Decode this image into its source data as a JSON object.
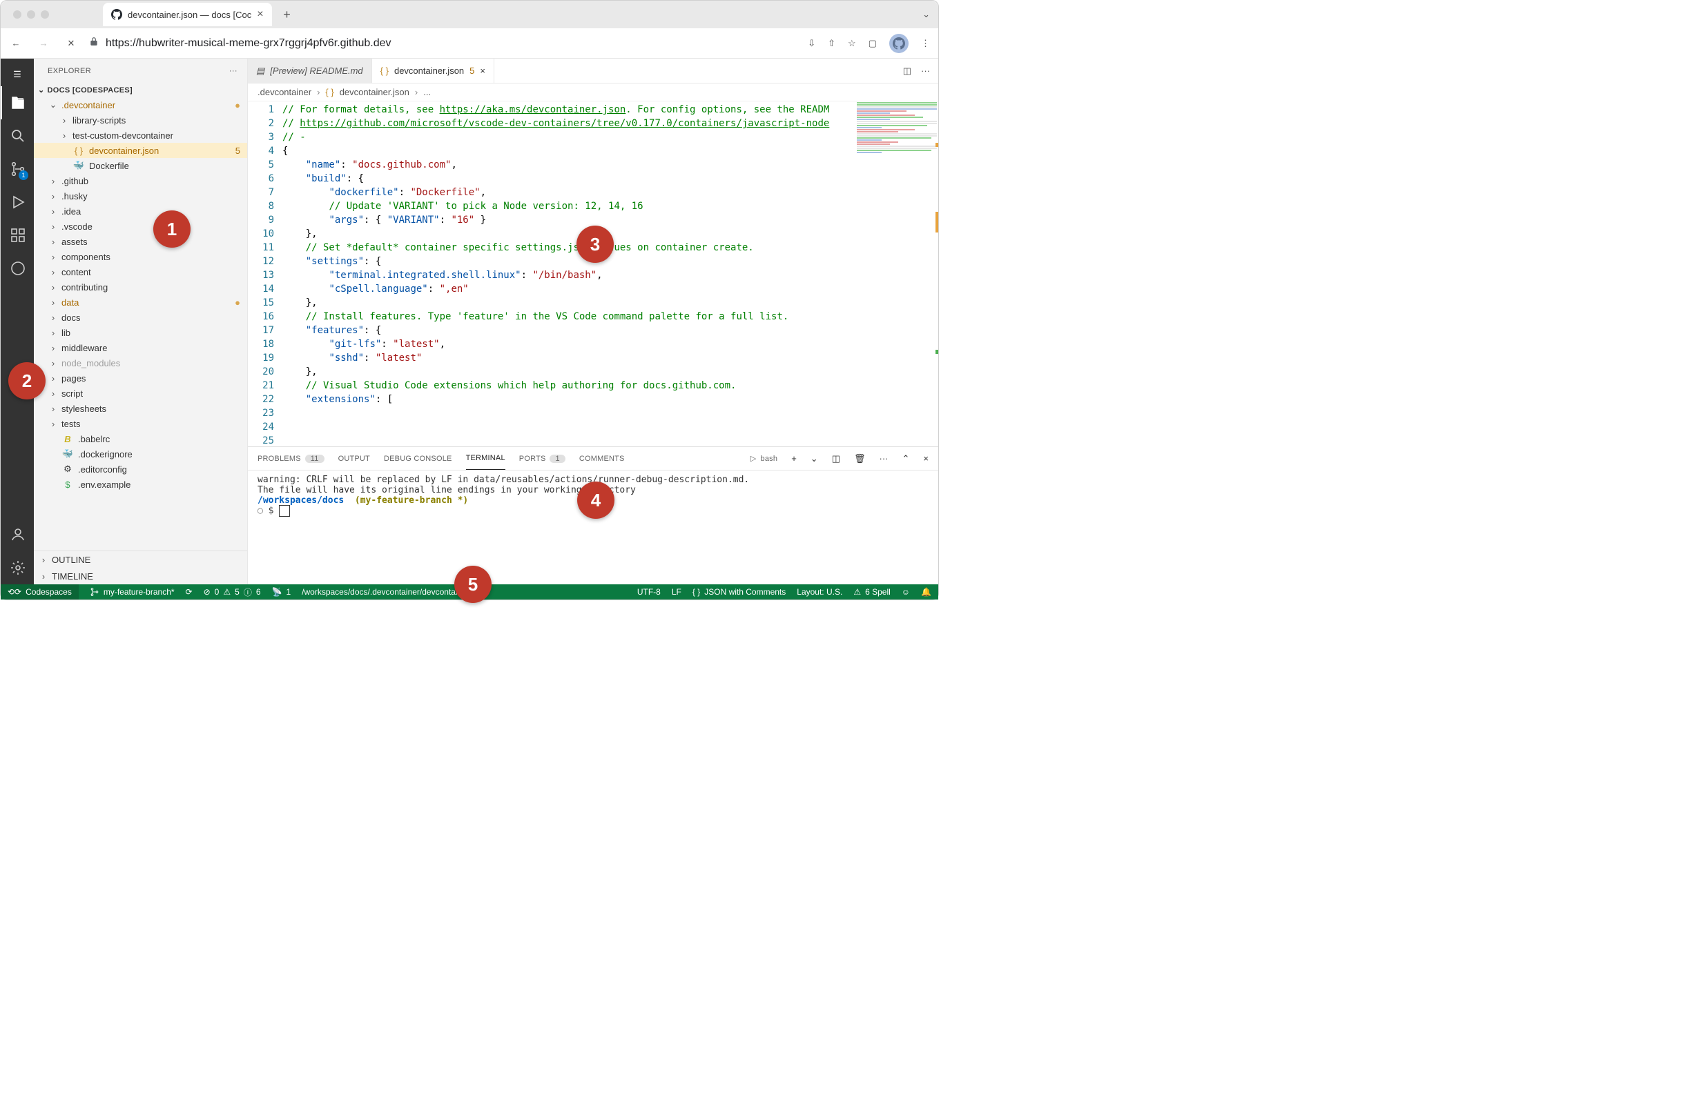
{
  "browser": {
    "tab_title": "devcontainer.json — docs [Coc",
    "url": "https://hubwriter-musical-meme-grx7rggrj4pfv6r.github.dev"
  },
  "sidebar": {
    "title": "EXPLORER",
    "section": "DOCS [CODESPACES]",
    "outline_label": "OUTLINE",
    "timeline_label": "TIMELINE",
    "tree": [
      {
        "indent": 1,
        "kind": "folder-open",
        "label": ".devcontainer",
        "class": "orange",
        "dot": true
      },
      {
        "indent": 2,
        "kind": "folder",
        "label": "library-scripts"
      },
      {
        "indent": 2,
        "kind": "folder",
        "label": "test-custom-devcontainer"
      },
      {
        "indent": 2,
        "kind": "json",
        "label": "devcontainer.json",
        "class": "orange",
        "selected": true,
        "badge": "5"
      },
      {
        "indent": 2,
        "kind": "docker",
        "label": "Dockerfile"
      },
      {
        "indent": 1,
        "kind": "folder",
        "label": ".github"
      },
      {
        "indent": 1,
        "kind": "folder",
        "label": ".husky"
      },
      {
        "indent": 1,
        "kind": "folder",
        "label": ".idea"
      },
      {
        "indent": 1,
        "kind": "folder",
        "label": ".vscode"
      },
      {
        "indent": 1,
        "kind": "folder",
        "label": "assets"
      },
      {
        "indent": 1,
        "kind": "folder",
        "label": "components"
      },
      {
        "indent": 1,
        "kind": "folder",
        "label": "content"
      },
      {
        "indent": 1,
        "kind": "folder",
        "label": "contributing"
      },
      {
        "indent": 1,
        "kind": "folder",
        "label": "data",
        "class": "orange",
        "dot": true
      },
      {
        "indent": 1,
        "kind": "folder",
        "label": "docs"
      },
      {
        "indent": 1,
        "kind": "folder",
        "label": "lib"
      },
      {
        "indent": 1,
        "kind": "folder",
        "label": "middleware"
      },
      {
        "indent": 1,
        "kind": "folder",
        "label": "node_modules",
        "class": "muted"
      },
      {
        "indent": 1,
        "kind": "folder",
        "label": "pages"
      },
      {
        "indent": 1,
        "kind": "folder",
        "label": "script"
      },
      {
        "indent": 1,
        "kind": "folder",
        "label": "stylesheets"
      },
      {
        "indent": 1,
        "kind": "folder",
        "label": "tests"
      },
      {
        "indent": 1,
        "kind": "babel",
        "label": ".babelrc"
      },
      {
        "indent": 1,
        "kind": "docker2",
        "label": ".dockerignore"
      },
      {
        "indent": 1,
        "kind": "gear",
        "label": ".editorconfig"
      },
      {
        "indent": 1,
        "kind": "env",
        "label": ".env.example"
      }
    ]
  },
  "activity_badge": "1",
  "tabs": {
    "tab1": "[Preview] README.md",
    "tab2": "devcontainer.json",
    "tab2_badge": "5"
  },
  "breadcrumbs": {
    "b1": ".devcontainer",
    "b2": "devcontainer.json",
    "b3": "..."
  },
  "code_lines": [
    [
      [
        "c",
        "// For format details, see "
      ],
      [
        "c u",
        "https://aka.ms/devcontainer.json"
      ],
      [
        "c",
        ". For config options, see the READM"
      ]
    ],
    [
      [
        "c",
        "// "
      ],
      [
        "c u",
        "https://github.com/microsoft/vscode-dev-containers/tree/v0.177.0/containers/javascript-node"
      ]
    ],
    [
      [
        "c",
        "// -"
      ]
    ],
    [
      [
        "b",
        "{"
      ]
    ],
    [
      [
        "b",
        "    "
      ],
      [
        "k",
        "\"name\""
      ],
      [
        "b",
        ": "
      ],
      [
        "s",
        "\"docs.github.com\""
      ],
      [
        "b",
        ","
      ]
    ],
    [
      [
        "b",
        "    "
      ],
      [
        "k",
        "\"build\""
      ],
      [
        "b",
        ": {"
      ]
    ],
    [
      [
        "b",
        "        "
      ],
      [
        "k",
        "\"dockerfile\""
      ],
      [
        "b",
        ": "
      ],
      [
        "s",
        "\"Dockerfile\""
      ],
      [
        "b",
        ","
      ]
    ],
    [
      [
        "b",
        "        "
      ],
      [
        "c",
        "// Update 'VARIANT' to pick a Node version: 12, 14, 16"
      ]
    ],
    [
      [
        "b",
        "        "
      ],
      [
        "k",
        "\"args\""
      ],
      [
        "b",
        ": { "
      ],
      [
        "k",
        "\"VARIANT\""
      ],
      [
        "b",
        ": "
      ],
      [
        "s",
        "\"16\""
      ],
      [
        "b",
        " }"
      ]
    ],
    [
      [
        "b",
        "    },"
      ]
    ],
    [
      [
        "b",
        ""
      ]
    ],
    [
      [
        "b",
        "    "
      ],
      [
        "c",
        "// Set *default* container specific settings.json values on container create."
      ]
    ],
    [
      [
        "b",
        "    "
      ],
      [
        "k",
        "\"settings\""
      ],
      [
        "b",
        ": {"
      ]
    ],
    [
      [
        "b",
        "        "
      ],
      [
        "k",
        "\"terminal.integrated.shell.linux\""
      ],
      [
        "b",
        ": "
      ],
      [
        "s",
        "\"/bin/bash\""
      ],
      [
        "b",
        ","
      ]
    ],
    [
      [
        "b",
        "        "
      ],
      [
        "k",
        "\"cSpell.language\""
      ],
      [
        "b",
        ": "
      ],
      [
        "s",
        "\",en\""
      ]
    ],
    [
      [
        "b",
        "    },"
      ]
    ],
    [
      [
        "b",
        ""
      ]
    ],
    [
      [
        "b",
        "    "
      ],
      [
        "c",
        "// Install features. Type 'feature' in the VS Code command palette for a full list."
      ]
    ],
    [
      [
        "b",
        "    "
      ],
      [
        "k",
        "\"features\""
      ],
      [
        "b",
        ": {"
      ]
    ],
    [
      [
        "b",
        "        "
      ],
      [
        "k",
        "\"git-lfs\""
      ],
      [
        "b",
        ": "
      ],
      [
        "s",
        "\"latest\""
      ],
      [
        "b",
        ","
      ]
    ],
    [
      [
        "b",
        "        "
      ],
      [
        "k",
        "\"sshd\""
      ],
      [
        "b",
        ": "
      ],
      [
        "s",
        "\"latest\""
      ]
    ],
    [
      [
        "b",
        "    },"
      ]
    ],
    [
      [
        "b",
        ""
      ]
    ],
    [
      [
        "b",
        "    "
      ],
      [
        "c",
        "// Visual Studio Code extensions which help authoring for docs.github.com."
      ]
    ],
    [
      [
        "b",
        "    "
      ],
      [
        "k",
        "\"extensions\""
      ],
      [
        "b",
        ": ["
      ]
    ]
  ],
  "panel": {
    "problems": "PROBLEMS",
    "problems_count": "11",
    "output": "OUTPUT",
    "debug": "DEBUG CONSOLE",
    "terminal": "TERMINAL",
    "ports": "PORTS",
    "ports_count": "1",
    "comments": "COMMENTS",
    "shell_label": "bash"
  },
  "terminal": {
    "line1": "warning: CRLF will be replaced by LF in data/reusables/actions/runner-debug-description.md.",
    "line2": "The file will have its original line endings in your working directory",
    "cwd": "/workspaces/docs",
    "branch": "(my-feature-branch *)",
    "prompt": "$ "
  },
  "statusbar": {
    "codespaces": "Codespaces",
    "branch": "my-feature-branch*",
    "errors": "0",
    "warnings": "5",
    "info": "6",
    "ports": "1",
    "path": "/workspaces/docs/.devcontainer/devcontainer.json",
    "encoding": "UTF-8",
    "eol": "LF",
    "lang": "JSON with Comments",
    "layout": "Layout: U.S.",
    "spell": "6 Spell"
  },
  "annotations": {
    "a1": "1",
    "a2": "2",
    "a3": "3",
    "a4": "4",
    "a5": "5"
  }
}
